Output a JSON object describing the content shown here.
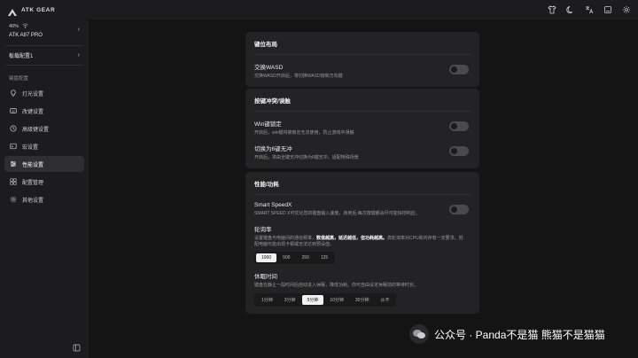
{
  "app": {
    "brand": "ATK GEAR"
  },
  "topbar": {
    "icons": [
      "shirt-icon",
      "moon-icon",
      "translate-icon",
      "minimize-icon",
      "settings-icon"
    ]
  },
  "device": {
    "battery": "40%",
    "name": "ATK A87 PRO"
  },
  "profile": {
    "label": "板载配置1"
  },
  "sidebar": {
    "section_label": "键盘配置",
    "items": [
      {
        "label": "灯光设置",
        "icon": "lightbulb-icon",
        "active": false
      },
      {
        "label": "改键设置",
        "icon": "keyboard-icon",
        "active": false
      },
      {
        "label": "高级键设置",
        "icon": "advanced-key-icon",
        "active": false
      },
      {
        "label": "宏设置",
        "icon": "macro-icon",
        "active": false
      },
      {
        "label": "性能设置",
        "icon": "sliders-icon",
        "active": true
      },
      {
        "label": "配置管理",
        "icon": "grid-icon",
        "active": false
      },
      {
        "label": "其他设置",
        "icon": "gear-icon",
        "active": false
      }
    ]
  },
  "cards": {
    "layout": {
      "title": "键位布局",
      "swap_wasd": {
        "title": "交换WASD",
        "desc": "交换WASD开启后，将切换WASD按和方向键",
        "enabled": false
      }
    },
    "conflict": {
      "title": "按键冲突/误触",
      "win_lock": {
        "title": "Win键锁定",
        "desc": "开启后，win键将被锁定无法使用，防止游戏中误触",
        "enabled": false
      },
      "six_key": {
        "title": "切换为6键无冲",
        "desc": "开启后，将由全键无冲切换为6键无冲，适配特殊场景",
        "enabled": false
      }
    },
    "performance": {
      "title": "性能/功耗",
      "speedx": {
        "title": "Smart SpeedX",
        "desc": "SMART SPEED X可优化您的键盘输入速度。启用后,每次按键都会尽可能快地响应。",
        "enabled": false
      },
      "polling": {
        "title": "轮询率",
        "desc_a": "设置键盘与电脑间的通信频率，",
        "desc_b": "数值越高，延迟越低，但功耗越高。",
        "desc_c": "高轮询率对CPU和内存有一定要求，低配电脑可能出现卡顿或无法达到预设值。",
        "options": [
          "1000",
          "500",
          "250",
          "125"
        ],
        "selected": "1000"
      },
      "sleep": {
        "title": "休眠时间",
        "desc": "键盘在静止一段时间后自动进入休眠，降低功耗。你可自由设定休眠前的等待时长。",
        "options": [
          "1分钟",
          "3分钟",
          "5分钟",
          "10分钟",
          "30分钟",
          "从不"
        ],
        "selected": "5分钟"
      }
    }
  },
  "watermark": {
    "text": "公众号 · Panda不是猫 熊猫不是猫猫"
  }
}
